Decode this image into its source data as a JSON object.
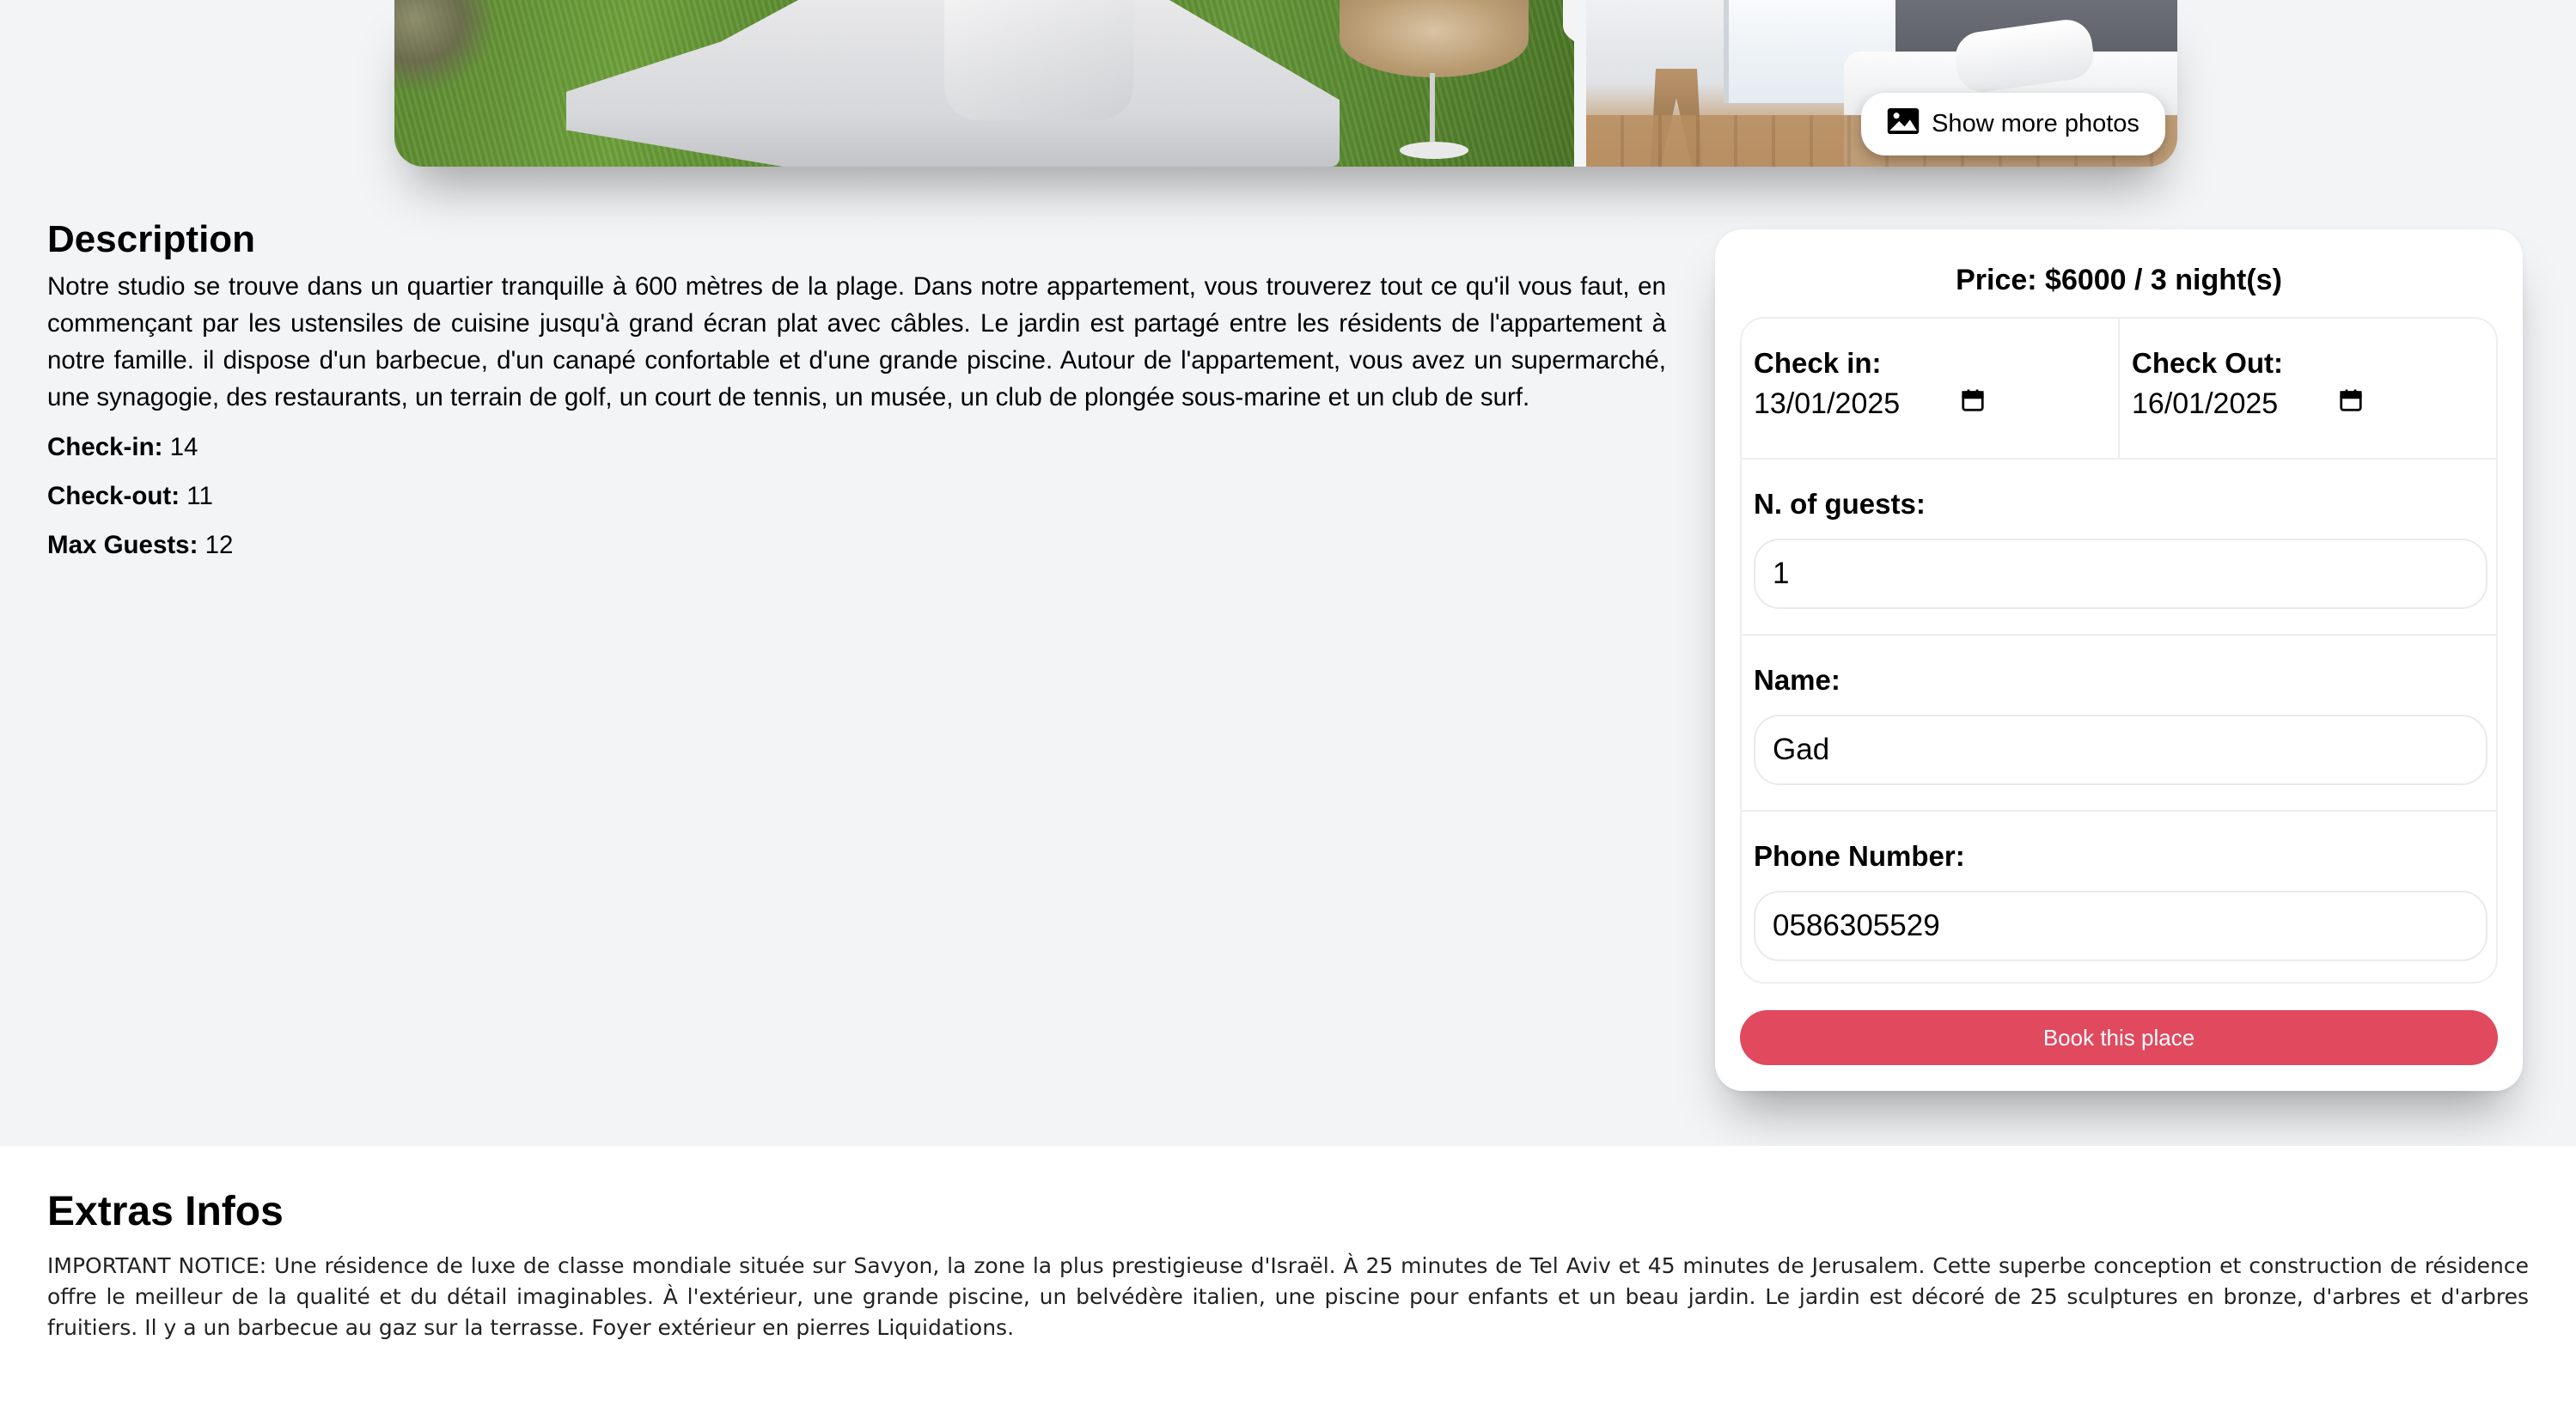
{
  "gallery": {
    "show_more_label": "Show more photos",
    "icon": "image-icon"
  },
  "description": {
    "title": "Description",
    "text": "Notre studio se trouve dans un quartier tranquille à 600 mètres de la plage. Dans notre appartement, vous trouverez tout ce qu'il vous faut, en commençant par les ustensiles de cuisine jusqu'à grand écran plat avec câbles. Le jardin est partagé entre les résidents de l'appartement à notre famille. il dispose d'un barbecue, d'un canapé confortable et d'une grande piscine. Autour de l'appartement, vous avez un supermarché, une synagogie, des restaurants, un terrain de golf, un court de tennis, un musée, un club de plongée sous-marine et un club de surf.",
    "checkin_label": "Check-in:",
    "checkin_value": "14",
    "checkout_label": "Check-out:",
    "checkout_value": "11",
    "max_guests_label": "Max Guests:",
    "max_guests_value": "12"
  },
  "booking": {
    "price_text": "Price: $6000 / 3 night(s)",
    "check_in_label": "Check in:",
    "check_in_value": "13/01/2025",
    "check_out_label": "Check Out:",
    "check_out_value": "16/01/2025",
    "guests_label": "N. of guests:",
    "guests_value": "1",
    "name_label": "Name:",
    "name_value": "Gad",
    "phone_label": "Phone Number:",
    "phone_value": "0586305529",
    "book_button": "Book this place",
    "accent_color": "#e0495e",
    "calendar_icon": "calendar-icon"
  },
  "extras": {
    "title": "Extras Infos",
    "text": "IMPORTANT NOTICE: Une résidence de luxe de classe mondiale située sur Savyon, la zone la plus prestigieuse d'Israël. À 25 minutes de Tel Aviv et 45 minutes de Jerusalem. Cette superbe conception et construction de résidence offre le meilleur de la qualité et du détail imaginables. À l'extérieur, une grande piscine, un belvédère italien, une piscine pour enfants et un beau jardin. Le jardin est décoré de 25 sculptures en bronze, d'arbres et d'arbres fruitiers. Il y a un barbecue au gaz sur la terrasse. Foyer extérieur en pierres Liquidations."
  }
}
